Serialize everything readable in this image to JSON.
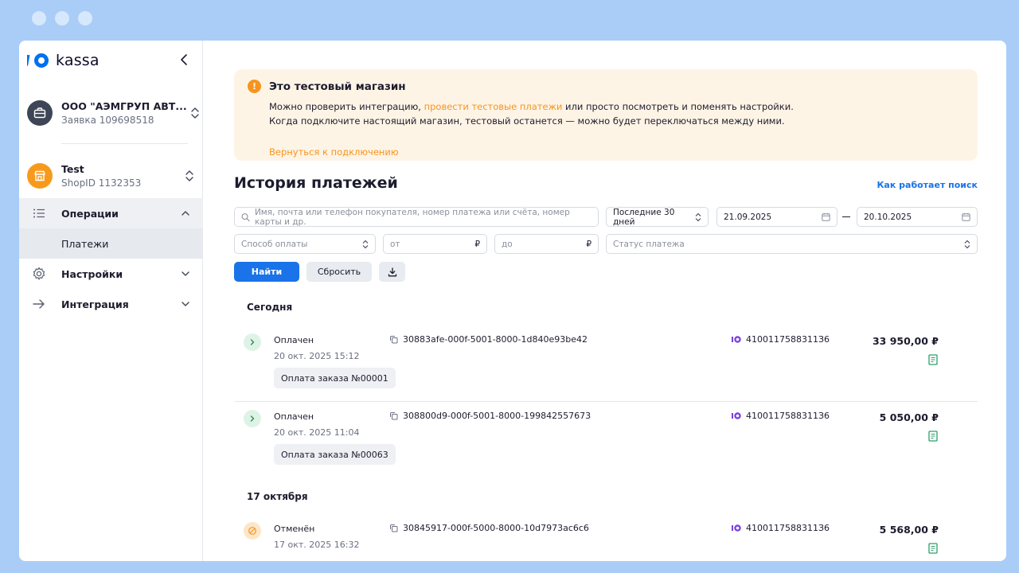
{
  "colors": {
    "accent": "#1a73e8",
    "warning": "#f7941d",
    "success_bg": "#def3e6",
    "cancel_bg": "#fde6c8",
    "frame": "#a9cdf7"
  },
  "brand": {
    "name": "kassa"
  },
  "sidebar": {
    "org": {
      "name": "ООО \"АЭМГРУП АВТ...",
      "sub": "Заявка 109698518"
    },
    "shop": {
      "name": "Test",
      "sub": "ShopID 1132353"
    },
    "items": [
      {
        "label": "Операции",
        "icon": "list-icon",
        "expanded": true
      },
      {
        "label": "Настройки",
        "icon": "gear-icon"
      },
      {
        "label": "Интеграция",
        "icon": "arrow-right-icon"
      }
    ],
    "sub_item": "Платежи"
  },
  "alert": {
    "title": "Это тестовый магазин",
    "line1_pre": "Можно проверить интеграцию, ",
    "line1_link": "провести тестовые платежи",
    "line1_post": " или просто посмотреть и поменять настройки.",
    "line2": "Когда подключите настоящий магазин, тестовый останется — можно будет переключаться между ними.",
    "back_link": "Вернуться к подключению"
  },
  "page": {
    "title": "История платежей",
    "help_link": "Как работает поиск"
  },
  "filters": {
    "search_placeholder": "Имя, почта или телефон покупателя, номер платежа или счёта, номер карты и др.",
    "period": "Последние 30 дней",
    "date_from": "21.09.2025",
    "date_to": "20.10.2025",
    "method_placeholder": "Способ оплаты",
    "amount_from_placeholder": "от",
    "amount_to_placeholder": "до",
    "currency": "₽",
    "status_placeholder": "Статус платежа",
    "find_label": "Найти",
    "reset_label": "Сбросить"
  },
  "groups": [
    {
      "day": "Сегодня"
    },
    {
      "day": "17 октября"
    }
  ],
  "payments": [
    {
      "status": "Оплачен",
      "date": "20 окт. 2025 15:12",
      "order": "Оплата заказа №00001",
      "id": "30883afe-000f-5001-8000-1d840e93be42",
      "account": "4100117588311З6",
      "amount": "33 950,00 ₽"
    },
    {
      "status": "Оплачен",
      "date": "20 окт. 2025 11:04",
      "order": "Оплата заказа №00063",
      "id": "308800d9-000f-5001-8000-199842557673",
      "account": "4100117588311З6",
      "amount": "5 050,00 ₽"
    },
    {
      "status": "Отменён",
      "date": "17 окт. 2025 16:32",
      "id": "30845917-000f-5000-8000-10d7973ac6c6",
      "account": "4100117588311З6",
      "amount": "5 568,00 ₽"
    }
  ]
}
